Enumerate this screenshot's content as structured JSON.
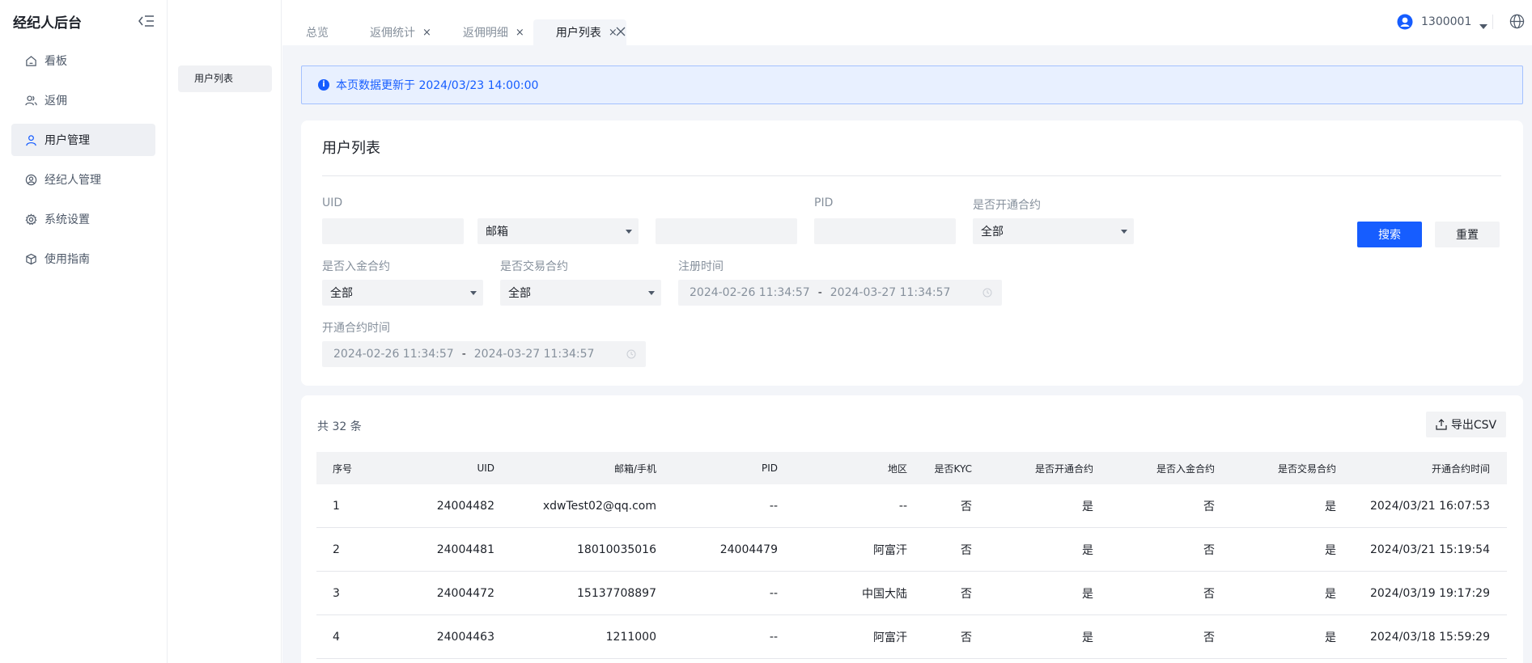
{
  "sidebar": {
    "brand": "经纪人后台",
    "items": [
      {
        "label": "看板",
        "icon": "home-icon"
      },
      {
        "label": "返佣",
        "icon": "users-icon"
      },
      {
        "label": "用户管理",
        "icon": "user-icon"
      },
      {
        "label": "经纪人管理",
        "icon": "user-circle-icon"
      },
      {
        "label": "系统设置",
        "icon": "gear-icon"
      },
      {
        "label": "使用指南",
        "icon": "cube-icon"
      }
    ]
  },
  "subnav": {
    "item": "用户列表"
  },
  "tabs": [
    {
      "label": "总览"
    },
    {
      "label": "返佣统计"
    },
    {
      "label": "返佣明细"
    },
    {
      "label": "用户列表"
    }
  ],
  "user": {
    "name": "1300001"
  },
  "notice": {
    "text": "本页数据更新于 2024/03/23 14:00:00"
  },
  "filter": {
    "title": "用户列表",
    "uid_label": "UID",
    "contact_type": "邮箱",
    "pid_label": "PID",
    "contract_open_label": "是否开通合约",
    "contract_open_value": "全部",
    "deposit_label": "是否入金合约",
    "deposit_value": "全部",
    "trade_label": "是否交易合约",
    "trade_value": "全部",
    "register_label": "注册时间",
    "register_start": "2024-02-26 11:34:57",
    "register_end": "2024-03-27 11:34:57",
    "open_time_label": "开通合约时间",
    "open_start": "2024-02-26 11:34:57",
    "open_end": "2024-03-27 11:34:57",
    "range_sep": "-",
    "search_button": "搜索",
    "reset_button": "重置"
  },
  "table": {
    "total": "共 32 条",
    "export_button": "导出CSV",
    "headers": [
      "序号",
      "UID",
      "邮箱/手机",
      "PID",
      "地区",
      "是否KYC",
      "是否开通合约",
      "是否入金合约",
      "是否交易合约",
      "开通合约时间"
    ],
    "rows": [
      [
        "1",
        "24004482",
        "xdwTest02@qq.com",
        "--",
        "--",
        "否",
        "是",
        "否",
        "是",
        "2024/03/21 16:07:53"
      ],
      [
        "2",
        "24004481",
        "18010035016",
        "24004479",
        "阿富汗",
        "否",
        "是",
        "否",
        "是",
        "2024/03/21 15:19:54"
      ],
      [
        "3",
        "24004472",
        "15137708897",
        "--",
        "中国大陆",
        "否",
        "是",
        "否",
        "是",
        "2024/03/19 19:17:29"
      ],
      [
        "4",
        "24004463",
        "1211000",
        "--",
        "阿富汗",
        "否",
        "是",
        "否",
        "是",
        "2024/03/18 15:59:29"
      ]
    ]
  },
  "colors": {
    "accent": "#165dff",
    "background": "#f3f5f9"
  }
}
